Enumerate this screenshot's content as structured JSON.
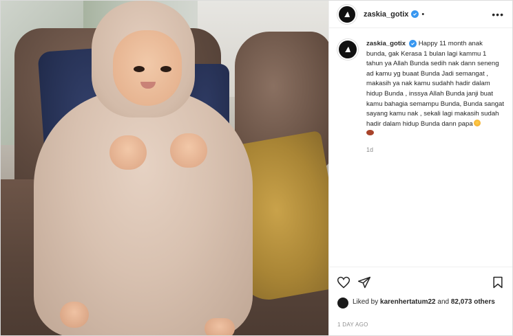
{
  "post": {
    "username": "zaskia_gotix",
    "separator": "•",
    "more_label": "•••",
    "caption": {
      "username": "zaskia_gotix",
      "text": "Happy 11 month anak bunda, gak Kerasa 1 bulan lagi kammu 1 tahun ya Allah Bunda sedih nak dann seneng ad kamu yg buaat Bunda Jadi semangat , makasih ya nak kamu sudahh hadir dalam hidup Bunda , inssya Allah Bunda janji buat kamu bahagia semampu Bunda, Bunda sangat sayang kamu nak , sekali lagi makasih sudah hadir dalam hidup Bunda dann papa",
      "time": "1d"
    },
    "likes": {
      "prefix": "Liked by",
      "user": "karenhertatum22",
      "joiner": "and",
      "count": "82,073 others"
    },
    "date": "1 DAY AGO",
    "icons": {
      "like": "heart-icon",
      "share": "paper-plane-icon",
      "save": "bookmark-icon",
      "verified": "verified-badge-icon"
    },
    "colors": {
      "verified": "#3897f0",
      "text": "#262626",
      "muted": "#8e8e8e"
    }
  }
}
